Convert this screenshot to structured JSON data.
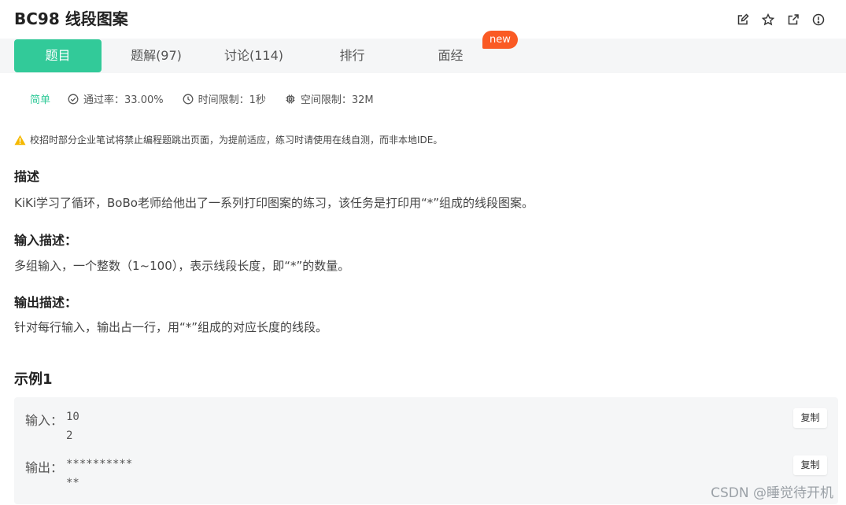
{
  "problem": {
    "title": "BC98  线段图案"
  },
  "tabs": [
    {
      "label": "题目",
      "active": true
    },
    {
      "label": "题解(97)"
    },
    {
      "label": "讨论(114)"
    },
    {
      "label": "排行"
    },
    {
      "label": "面经"
    }
  ],
  "new_badge": "new",
  "meta": {
    "difficulty": "简单",
    "pass_rate": "通过率：33.00%",
    "time_limit": "时间限制：1秒",
    "space_limit": "空间限制：32M"
  },
  "warning": "校招时部分企业笔试将禁止编程题跳出页面，为提前适应，练习时请使用在线自测，而非本地IDE。",
  "sections": {
    "desc_title": "描述",
    "desc_text": "KiKi学习了循环，BoBo老师给他出了一系列打印图案的练习，该任务是打印用“*”组成的线段图案。",
    "input_title": "输入描述：",
    "input_text": "多组输入，一个整数（1~100），表示线段长度，即“*”的数量。",
    "output_title": "输出描述：",
    "output_text": "针对每行输入，输出占一行，用“*”组成的对应长度的线段。"
  },
  "example": {
    "title": "示例1",
    "input_label": "输入：",
    "input_value": "10\n2",
    "output_label": "输出：",
    "output_value": "**********\n**",
    "copy_label": "复制"
  },
  "watermark": "CSDN @睡觉待开机",
  "colors": {
    "accent": "#32ca99",
    "badge": "#fa5a24",
    "warning": "#f5b800"
  },
  "icons": [
    "edit-icon",
    "star-icon",
    "share-icon",
    "report-icon",
    "check-circle-icon",
    "clock-icon",
    "chip-icon",
    "warning-icon"
  ]
}
